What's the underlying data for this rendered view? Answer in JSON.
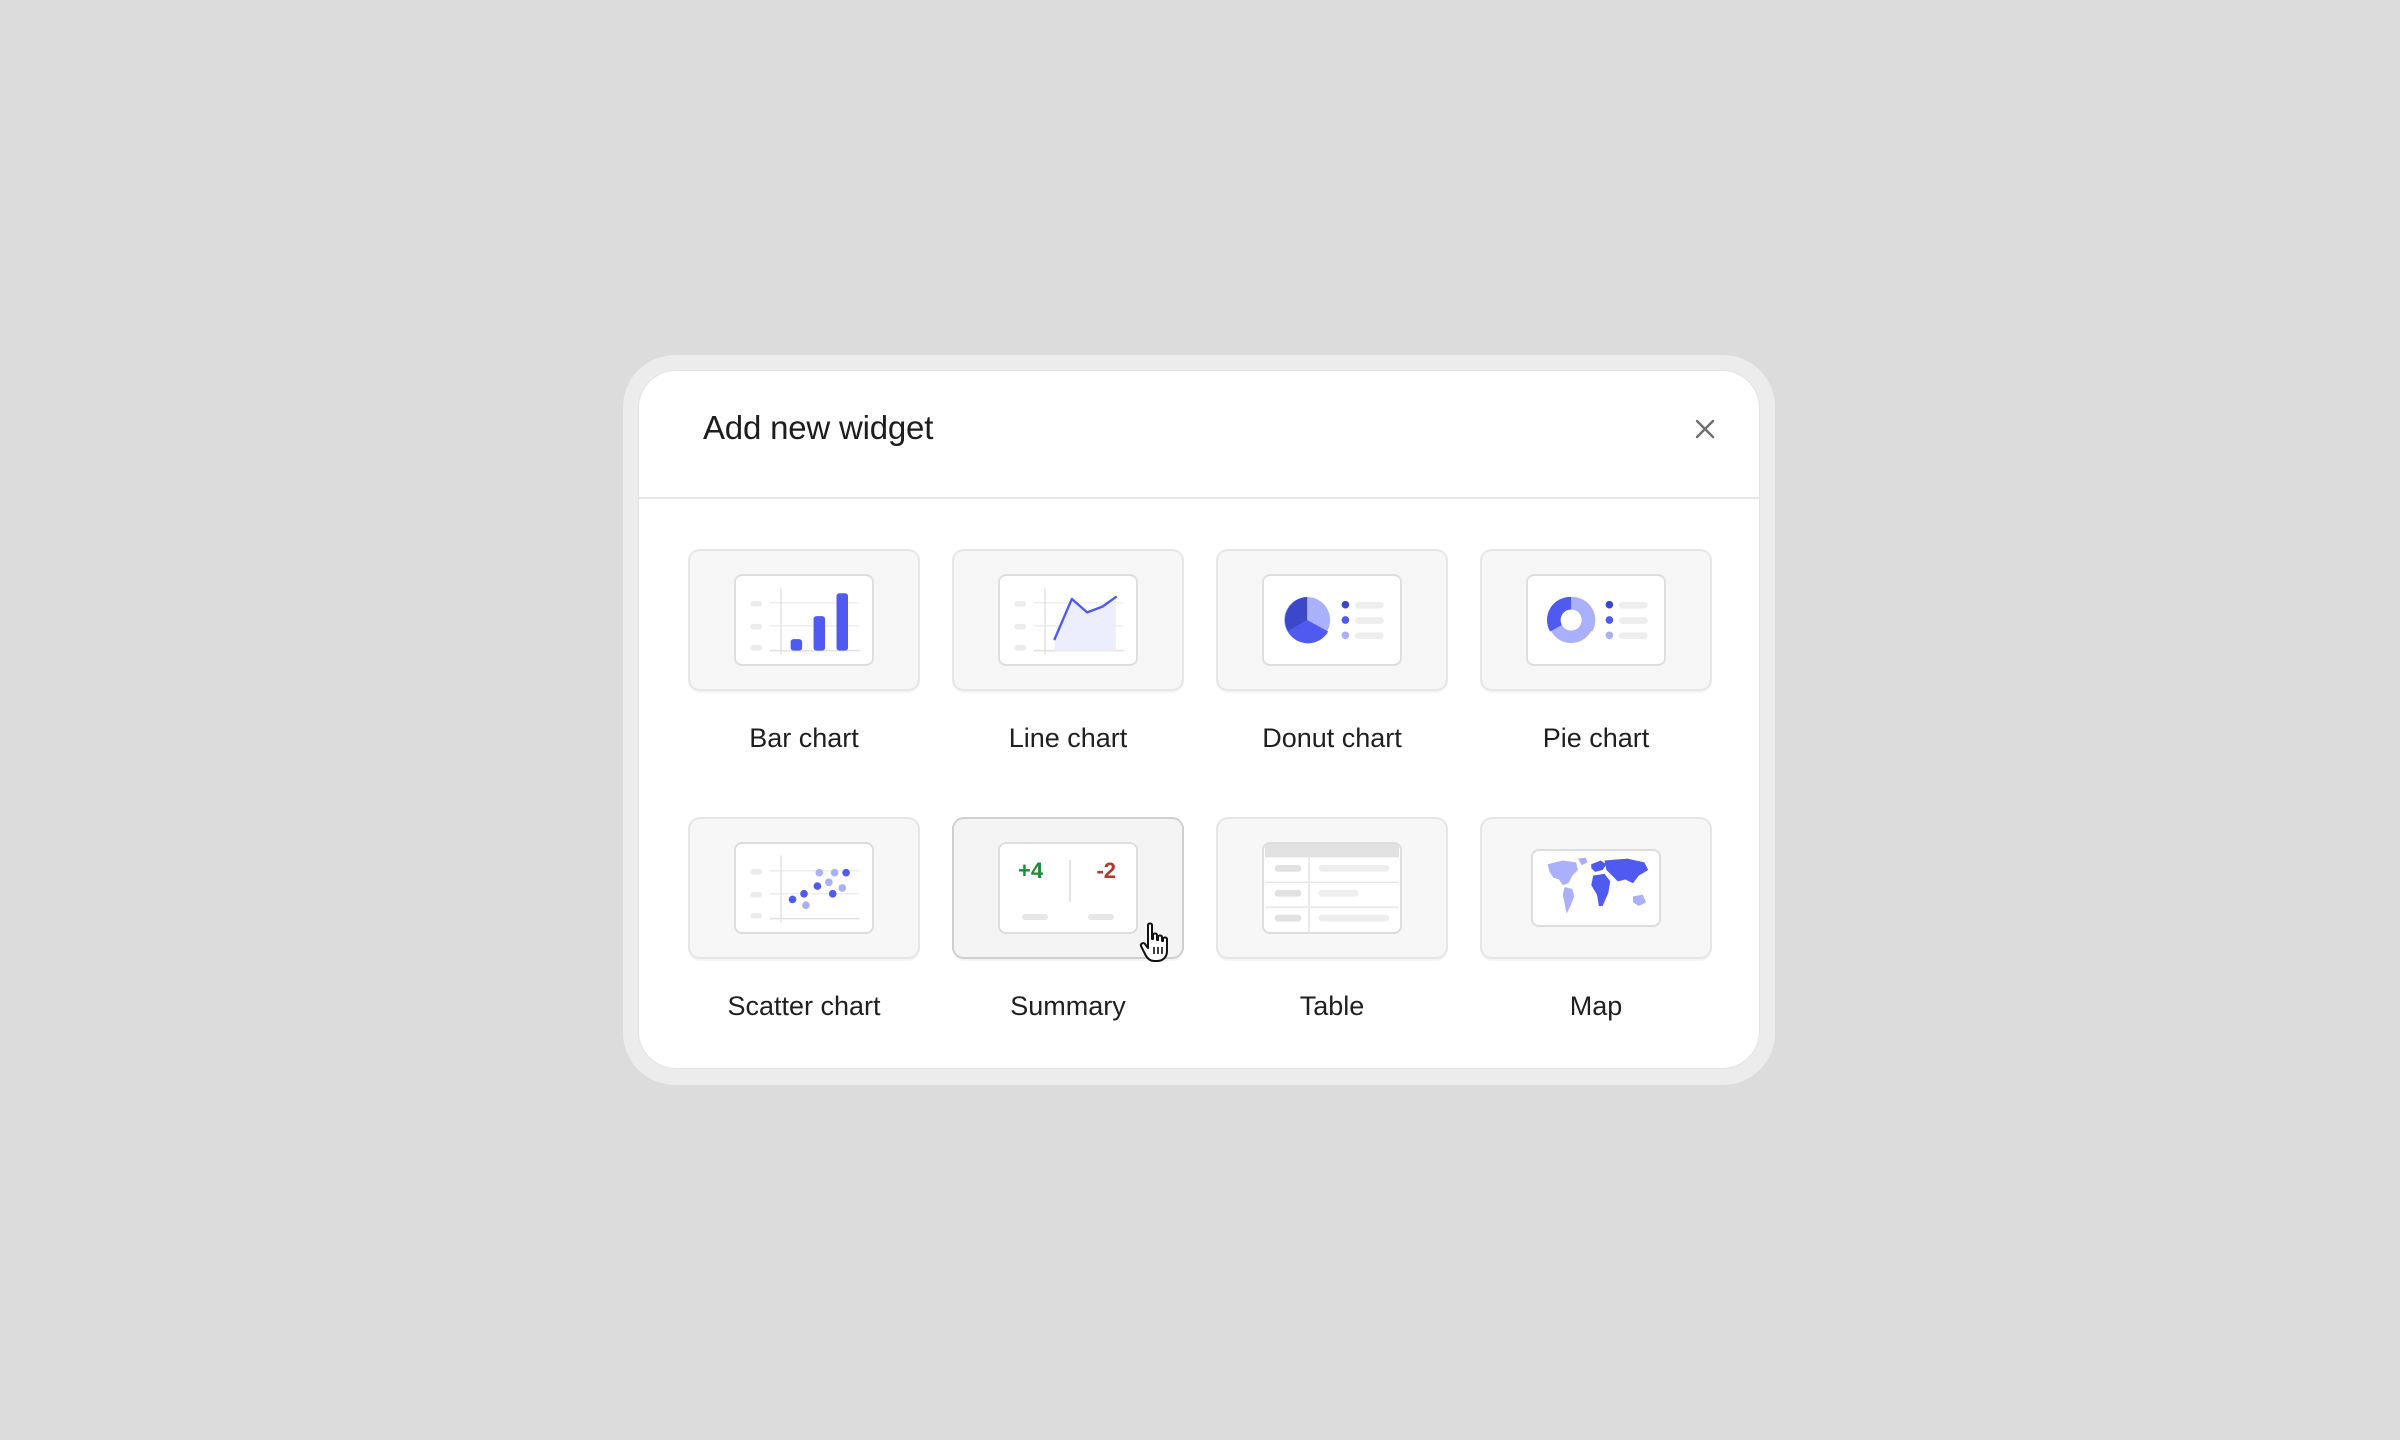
{
  "dialog": {
    "title": "Add new widget",
    "close_icon": "close-icon"
  },
  "widgets": [
    {
      "label": "Bar chart",
      "icon": "bar-chart-icon"
    },
    {
      "label": "Line chart",
      "icon": "line-chart-icon"
    },
    {
      "label": "Donut chart",
      "icon": "donut-chart-icon"
    },
    {
      "label": "Pie chart",
      "icon": "pie-chart-icon"
    },
    {
      "label": "Scatter chart",
      "icon": "scatter-chart-icon"
    },
    {
      "label": "Summary",
      "icon": "summary-icon",
      "hovered": true
    },
    {
      "label": "Table",
      "icon": "table-icon"
    },
    {
      "label": "Map",
      "icon": "map-icon"
    }
  ],
  "summary_preview": {
    "positive": "+4",
    "negative": "-2"
  },
  "colors": {
    "accent": "#4f5bf0",
    "accent_light": "#aab0fb",
    "accent_dark": "#3d47c9",
    "positive": "#1f8a3c",
    "negative": "#b03a2e",
    "backdrop": "#dcdcdc"
  }
}
